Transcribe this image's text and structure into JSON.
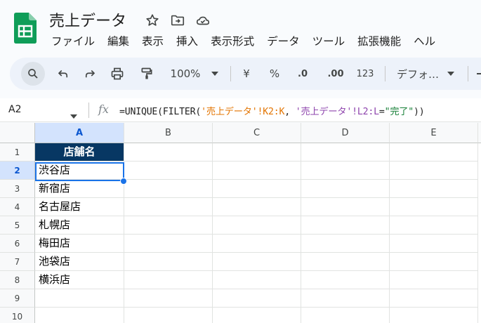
{
  "document": {
    "title": "売上データ"
  },
  "icons": {
    "star": "star-icon",
    "move": "move-to-folder-icon",
    "cloud": "cloud-saved-icon"
  },
  "menu": [
    "ファイル",
    "編集",
    "表示",
    "挿入",
    "表示形式",
    "データ",
    "ツール",
    "拡張機能",
    "ヘル"
  ],
  "toolbar": {
    "zoom": "100%",
    "currency": "¥",
    "percent": "%",
    "dec_decrease": ".0",
    "dec_increase": ".00",
    "number_format": "123",
    "font": "デフォ…"
  },
  "formula_bar": {
    "cell_ref": "A2",
    "fx": "fx",
    "formula_parts": [
      "=UNIQUE(FILTER(",
      "'売上データ'!K2:K",
      ", ",
      "'売上データ'!L2:L",
      "=",
      "\"完了\"",
      "))"
    ]
  },
  "grid": {
    "columns": [
      "A",
      "B",
      "C",
      "D",
      "E"
    ],
    "rows": [
      "1",
      "2",
      "3",
      "4",
      "5",
      "6",
      "7",
      "8",
      "9",
      "10"
    ],
    "selected_column": "A",
    "selected_row": "2",
    "column_a": [
      "店舗名",
      "渋谷店",
      "新宿店",
      "名古屋店",
      "札幌店",
      "梅田店",
      "池袋店",
      "横浜店",
      "",
      ""
    ]
  },
  "colors": {
    "header_fill": "#073763",
    "selection": "#1a73e8",
    "sheets_green": "#0f9d58"
  }
}
